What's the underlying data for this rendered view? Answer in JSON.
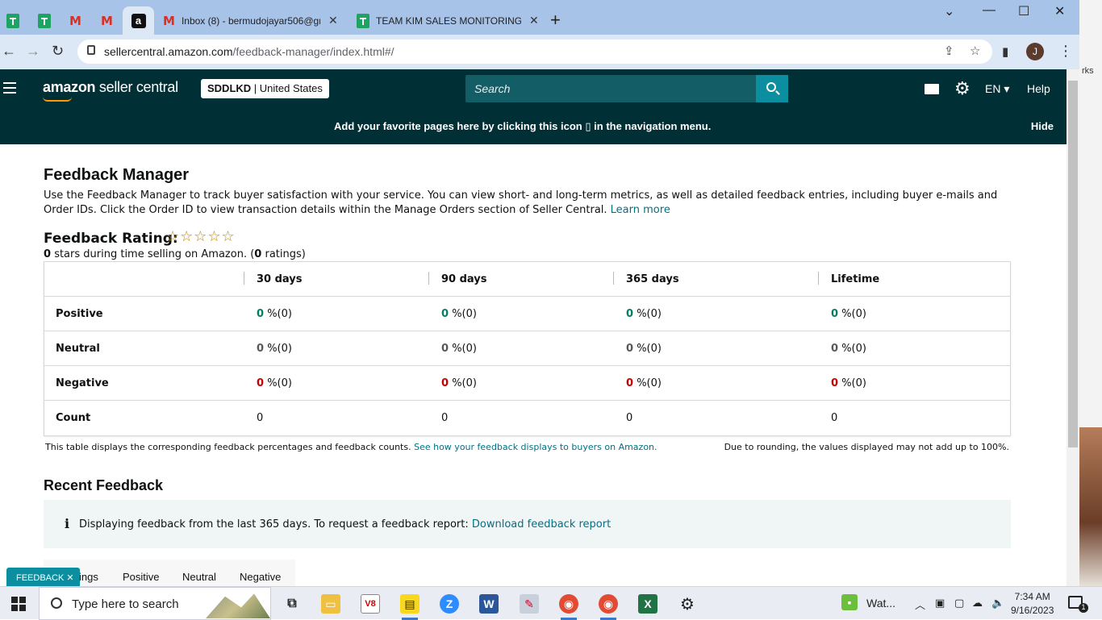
{
  "browser": {
    "tabs": [
      {
        "type": "sheets",
        "title": ""
      },
      {
        "type": "sheets",
        "title": ""
      },
      {
        "type": "gmail",
        "title": ""
      },
      {
        "type": "gmail",
        "title": ""
      },
      {
        "type": "amazon",
        "title": "",
        "active": true
      },
      {
        "type": "gmail",
        "title": "Inbox (8) - bermudojayar506@gr"
      },
      {
        "type": "sheets",
        "title": "TEAM KIM SALES MONITORING"
      }
    ],
    "tab_close": "✕",
    "new_tab": "+",
    "url_host": "sellercentral.amazon.com",
    "url_path": "/feedback-manager/index.html#/",
    "profile_initial": "J",
    "bookmark_fragment": "rks"
  },
  "header": {
    "logo_brand": "amazon",
    "logo_product": "seller central",
    "account_name": "SDDLKD",
    "account_region": "United States",
    "search_placeholder": "Search",
    "language": "EN",
    "help": "Help"
  },
  "fav_bar": {
    "message_before": "Add your favorite pages here by clicking this icon",
    "message_after": "in the navigation menu.",
    "hide": "Hide"
  },
  "page": {
    "title": "Feedback Manager",
    "intro": "Use the Feedback Manager to track buyer satisfaction with your service. You can view short- and long-term metrics, as well as detailed feedback entries, including buyer e-mails and Order IDs. Click the Order ID to view transaction details within the Manage Orders section of Seller Central.",
    "learn_more": "Learn more",
    "rating_title": "Feedback Rating:",
    "stars": "☆☆☆☆☆",
    "rating_stars_value": "0",
    "rating_sub_mid": "stars during time selling on Amazon. (",
    "rating_count": "0",
    "rating_sub_end": "ratings)"
  },
  "table": {
    "columns": [
      "30 days",
      "90 days",
      "365 days",
      "Lifetime"
    ],
    "rows": [
      {
        "label": "Positive",
        "cells": [
          [
            "0",
            "%(0)"
          ],
          [
            "0",
            "%(0)"
          ],
          [
            "0",
            "%(0)"
          ],
          [
            "0",
            "%(0)"
          ]
        ]
      },
      {
        "label": "Neutral",
        "cells": [
          [
            "0",
            "%(0)"
          ],
          [
            "0",
            "%(0)"
          ],
          [
            "0",
            "%(0)"
          ],
          [
            "0",
            "%(0)"
          ]
        ]
      },
      {
        "label": "Negative",
        "cells": [
          [
            "0",
            "%(0)"
          ],
          [
            "0",
            "%(0)"
          ],
          [
            "0",
            "%(0)"
          ],
          [
            "0",
            "%(0)"
          ]
        ]
      },
      {
        "label": "Count",
        "cells": [
          [
            "0",
            ""
          ],
          [
            "0",
            ""
          ],
          [
            "0",
            ""
          ],
          [
            "0",
            ""
          ]
        ]
      }
    ],
    "note": "This table displays the corresponding feedback percentages and feedback counts.",
    "note_link": "See how your feedback displays to buyers on Amazon.",
    "note_right": "Due to rounding, the values displayed may not add up to 100%."
  },
  "recent": {
    "title": "Recent Feedback",
    "info_icon": "i",
    "info_text": "Displaying feedback from the last 365 days. To request a feedback report:",
    "info_link": "Download feedback report",
    "tabs": [
      "ings",
      "Positive",
      "Neutral",
      "Negative"
    ],
    "feedback_button": "FEEDBACK ✕"
  },
  "taskbar": {
    "search_placeholder": "Type here to search",
    "weather": "Wat...",
    "time": "7:34 AM",
    "date": "9/16/2023",
    "notification_count": "1"
  },
  "colors": {
    "header_bg": "#002f36",
    "link": "#007185",
    "positive": "#067d62",
    "negative": "#c40000",
    "feedback_button": "#0b8fa0"
  }
}
